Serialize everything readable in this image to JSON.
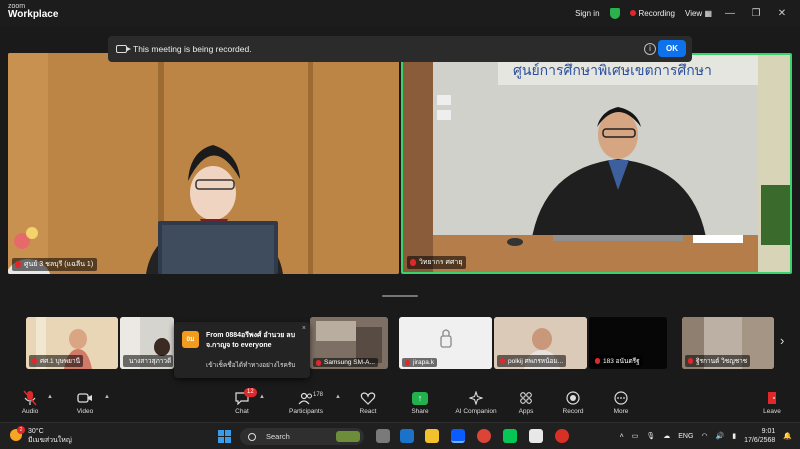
{
  "app": {
    "logo_top": "zoom",
    "logo_bottom": "Workplace",
    "sign_in": "Sign in",
    "recording": "Recording",
    "view": "View"
  },
  "banner": {
    "message": "This meeting is being recorded.",
    "info_icon": "i",
    "ok_label": "OK"
  },
  "main_tiles": [
    {
      "name": "ศูนย์ 3 ชลบุรี (แฉลีน 1)",
      "active_speaker": false
    },
    {
      "name": "วิทยากร ศศายุ",
      "active_speaker": true
    }
  ],
  "thumbnails": [
    {
      "name": "ศศ.1 บุษพยานี"
    },
    {
      "name": "นางสาวสุภาวดี"
    },
    {
      "name": "Samsung SM-A..."
    },
    {
      "name": "jirapa.k"
    },
    {
      "name": "polkij ศพภรหน้อม..."
    },
    {
      "name": "183 อนันตรีฐ"
    },
    {
      "name": "ฐิรกานต์ วิชญชาช"
    }
  ],
  "chat_popup": {
    "avatar": "0ม",
    "from": "From 0884อรีพงศ์ อำนวย ลบ จ.กาญจ to everyone",
    "message": "เข้าเช็คชื่อได้ทำทางอย่างไรครับ",
    "close": "×"
  },
  "toolbar": {
    "audio": "Audio",
    "video": "Video",
    "chat": "Chat",
    "chat_badge": "12",
    "participants": "Participants",
    "participants_count": "178",
    "react": "React",
    "share": "Share",
    "ai_companion": "AI Companion",
    "apps": "Apps",
    "record": "Record",
    "more": "More",
    "leave": "Leave"
  },
  "taskbar": {
    "weather_badge": "2",
    "temperature": "30°C",
    "weather_text": "มีเมฆส่วนใหญ่",
    "search_placeholder": "Search",
    "language": "ENG",
    "time": "9:01",
    "date": "17/6/2568"
  },
  "colors": {
    "accent_blue": "#0e72ed",
    "recording_red": "#e0282a",
    "active_speaker_green": "#38d46b",
    "share_green": "#22b14c"
  }
}
